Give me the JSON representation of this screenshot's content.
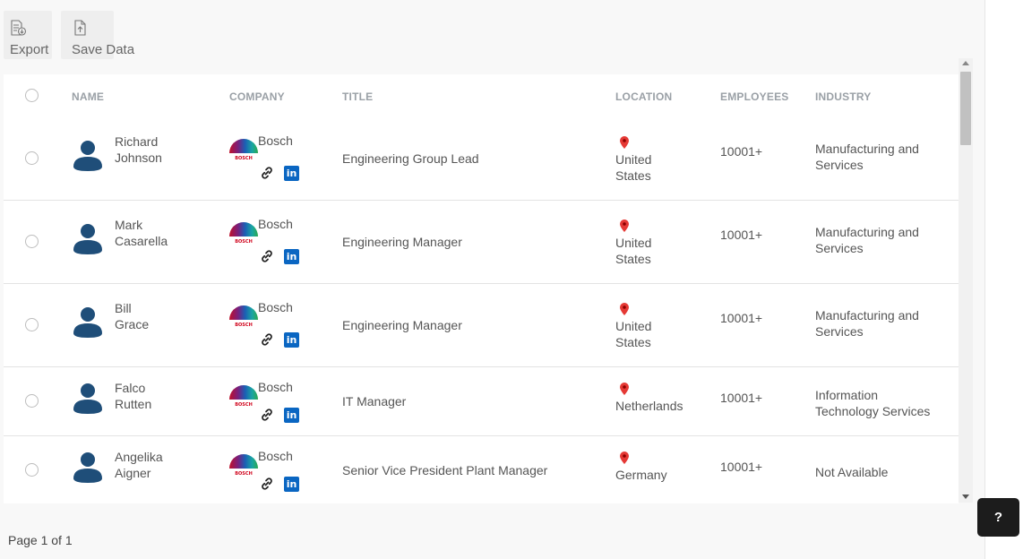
{
  "toolbar": {
    "export_label": "Export",
    "save_label": "Save Data"
  },
  "columns": {
    "name": "NAME",
    "company": "COMPANY",
    "title": "TITLE",
    "location": "LOCATION",
    "employees": "EMPLOYEES",
    "industry": "INDUSTRY"
  },
  "rows": [
    {
      "first": "Richard",
      "last": "Johnson",
      "company": "Bosch",
      "title": "Engineering Group Lead",
      "loc1": "United",
      "loc2": "States",
      "employees": "10001+",
      "ind1": "Manufacturing and",
      "ind2": "Services"
    },
    {
      "first": "Mark",
      "last": "Casarella",
      "company": "Bosch",
      "title": "Engineering Manager",
      "loc1": "United",
      "loc2": "States",
      "employees": "10001+",
      "ind1": "Manufacturing and",
      "ind2": "Services"
    },
    {
      "first": "Bill",
      "last": "Grace",
      "company": "Bosch",
      "title": "Engineering Manager",
      "loc1": "United",
      "loc2": "States",
      "employees": "10001+",
      "ind1": "Manufacturing and",
      "ind2": "Services"
    },
    {
      "first": "Falco",
      "last": "Rutten",
      "company": "Bosch",
      "title": "IT Manager",
      "loc1": "Netherlands",
      "loc2": "",
      "employees": "10001+",
      "ind1": "Information",
      "ind2": "Technology Services"
    },
    {
      "first": "Angelika",
      "last": "Aigner",
      "company": "Bosch",
      "title": "Senior Vice President Plant Manager",
      "loc1": "Germany",
      "loc2": "",
      "employees": "10001+",
      "ind1": "Not Available",
      "ind2": ""
    }
  ],
  "logo_text": "BOSCH",
  "linkedin_glyph": "in",
  "pagination": "Page 1 of 1",
  "help_label": "?",
  "colors": {
    "avatar": "#1f4e79",
    "pin": "#e53935",
    "linkedin": "#0a66c2",
    "help_bg": "#1c1c1c"
  }
}
